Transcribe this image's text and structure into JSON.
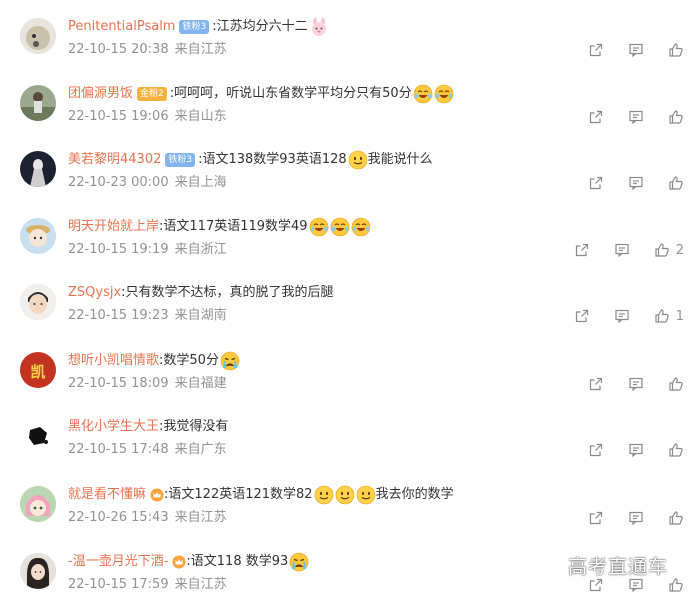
{
  "comments": [
    {
      "user": "PenitentialPsalm",
      "badge": "铁粉3",
      "badge_type": "blue",
      "text": ":江苏均分六十二",
      "emojis": [
        "bunny"
      ],
      "date": "22-10-15 20:38",
      "location": "来自江苏",
      "likes": "",
      "avatar": "pale"
    },
    {
      "user": "团偏源男饭",
      "badge": "金粉2",
      "badge_type": "gold",
      "text": ":呵呵呵，听说山东省数学平均分只有50分",
      "emojis": [
        "laugh",
        "laugh"
      ],
      "date": "22-10-15 19:06",
      "location": "来自山东",
      "likes": "",
      "avatar": "outdoor"
    },
    {
      "user": "美若黎明44302",
      "badge": "铁粉3",
      "badge_type": "blue",
      "text": ":语文138数学93英语128",
      "emojis": [
        "smile"
      ],
      "text2": "我能说什么",
      "date": "22-10-23 00:00",
      "location": "来自上海",
      "likes": "",
      "avatar": "dark"
    },
    {
      "user": "明天开始就上岸",
      "badge": "",
      "badge_type": "",
      "text": ":语文117英语119数学49",
      "emojis": [
        "laugh",
        "laugh",
        "laugh"
      ],
      "date": "22-10-15 19:19",
      "location": "来自浙江",
      "likes": "2",
      "avatar": "doll"
    },
    {
      "user": "ZSQysjx",
      "badge": "",
      "badge_type": "",
      "text": ":只有数学不达标，真的脱了我的后腿",
      "emojis": [],
      "date": "22-10-15 19:23",
      "location": "来自湖南",
      "likes": "1",
      "avatar": "boy"
    },
    {
      "user": "想听小凯唱情歌",
      "badge": "",
      "badge_type": "",
      "text": ":数学50分",
      "emojis": [
        "cry"
      ],
      "date": "22-10-15 18:09",
      "location": "来自福建",
      "likes": "",
      "avatar": "red"
    },
    {
      "user": "黑化小学生大王",
      "badge": "",
      "badge_type": "",
      "text": ":我觉得没有",
      "emojis": [],
      "date": "22-10-15 17:48",
      "location": "来自广东",
      "likes": "",
      "avatar": "black"
    },
    {
      "user": "就是看不懂嘛",
      "badge": "",
      "badge_type": "crown",
      "text": ":语文122英语121数学82",
      "emojis": [
        "smile",
        "smile",
        "smile"
      ],
      "text2": "我去你的数学",
      "date": "22-10-26 15:43",
      "location": "来自江苏",
      "likes": "",
      "avatar": "anime"
    },
    {
      "user": "-温一壶月光下酒-",
      "badge": "",
      "badge_type": "crown",
      "text": ":语文118 数学93",
      "emojis": [
        "cry"
      ],
      "date": "22-10-15 17:59",
      "location": "来自江苏",
      "likes": "",
      "avatar": "girl"
    }
  ],
  "watermark": "高考直通车",
  "icons": {
    "share": "share-icon",
    "reply": "comment-icon",
    "like": "thumbs-up-icon"
  },
  "colors": {
    "username": "#eb7350",
    "meta": "#939393",
    "text": "#333333"
  }
}
